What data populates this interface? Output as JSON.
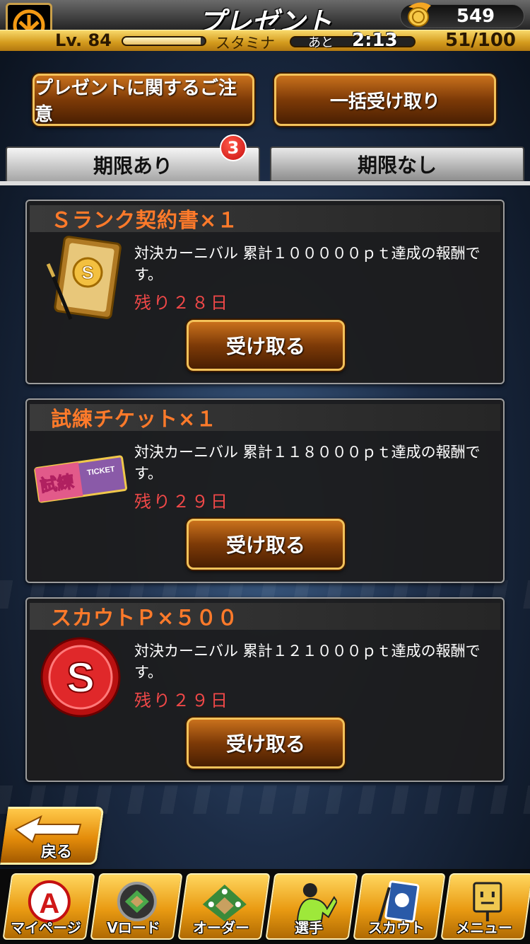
{
  "header": {
    "title": "プレゼント",
    "coins": "549",
    "level": "Lv. 84",
    "stamina_label": "スタミナ",
    "ato_label": "あと",
    "timer": "2:13",
    "stamina": "51/100",
    "exp_fraction": 0.95
  },
  "actions": {
    "notice_button": "プレゼントに関するご注意",
    "receive_all_button": "一括受け取り"
  },
  "tabs": [
    {
      "label": "期限あり",
      "badge": "3",
      "active": true
    },
    {
      "label": "期限なし",
      "active": false
    }
  ],
  "presents": [
    {
      "title": "Ｓランク契約書×１",
      "description": "対決カーニバル 累計１０００００ｐｔ達成の報酬です。",
      "remaining": "残り２８日",
      "button": "受け取る",
      "icon": "s-rank-contract-icon"
    },
    {
      "title": "試練チケット×１",
      "description": "対決カーニバル 累計１１８０００ｐｔ達成の報酬です。",
      "remaining": "残り２９日",
      "button": "受け取る",
      "icon": "trial-ticket-icon",
      "ticket_text": "試練",
      "ticket_sub": "TICKET"
    },
    {
      "title": "スカウトＰ×５００",
      "description": "対決カーニバル 累計１２１０００ｐｔ達成の報酬です。",
      "remaining": "残り２９日",
      "button": "受け取る",
      "icon": "scout-point-coin-icon",
      "coin_letter": "S"
    }
  ],
  "back_button": "戻る",
  "nav": [
    {
      "label": "マイページ",
      "icon": "my-page-icon",
      "letter": "A"
    },
    {
      "label": "Vロード",
      "icon": "v-road-icon"
    },
    {
      "label": "オーダー",
      "icon": "order-icon"
    },
    {
      "label": "選手",
      "icon": "players-icon"
    },
    {
      "label": "スカウト",
      "icon": "scout-icon"
    },
    {
      "label": "メニュー",
      "icon": "menu-icon"
    }
  ],
  "colors": {
    "accent": "#e48c0a",
    "item_title": "#ff7a2a",
    "remaining": "#f04848",
    "badge": "#c80e0e"
  }
}
